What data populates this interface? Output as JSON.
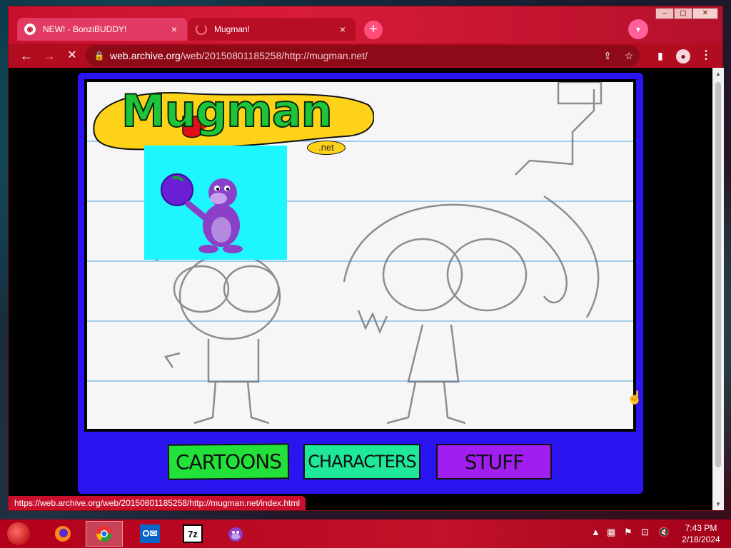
{
  "browser": {
    "tabs": [
      {
        "title": "NEW! - BonziBUDDY!",
        "close": "×"
      },
      {
        "title": "Mugman!",
        "close": "×"
      }
    ],
    "new_tab": "+",
    "url_host": "web.archive.org",
    "url_path": "/web/20150801185258/http://mugman.net/",
    "status_url": "https://web.archive.org/web/20150801185258/http://mugman.net/index.html"
  },
  "site": {
    "logo_text": "Mugman",
    "logo_net": ".net",
    "nav": [
      "CARTOONS",
      "CHARACTERS",
      "STUFF"
    ]
  },
  "taskbar": {
    "apps": [
      "firefox-icon",
      "chrome-icon",
      "outlook-icon",
      "7zip-icon",
      "bonzibuddy-icon"
    ],
    "sevenzip_label": "7z",
    "time": "7:43 PM",
    "date": "2/18/2024"
  },
  "colors": {
    "browser_frame": "#c8102e",
    "site_blue": "#2a14f0",
    "bonzi_bg": "#1ef6ff",
    "nav_cartoons": "#22e23a",
    "nav_characters": "#1fe89a",
    "nav_stuff": "#a11ef0"
  }
}
